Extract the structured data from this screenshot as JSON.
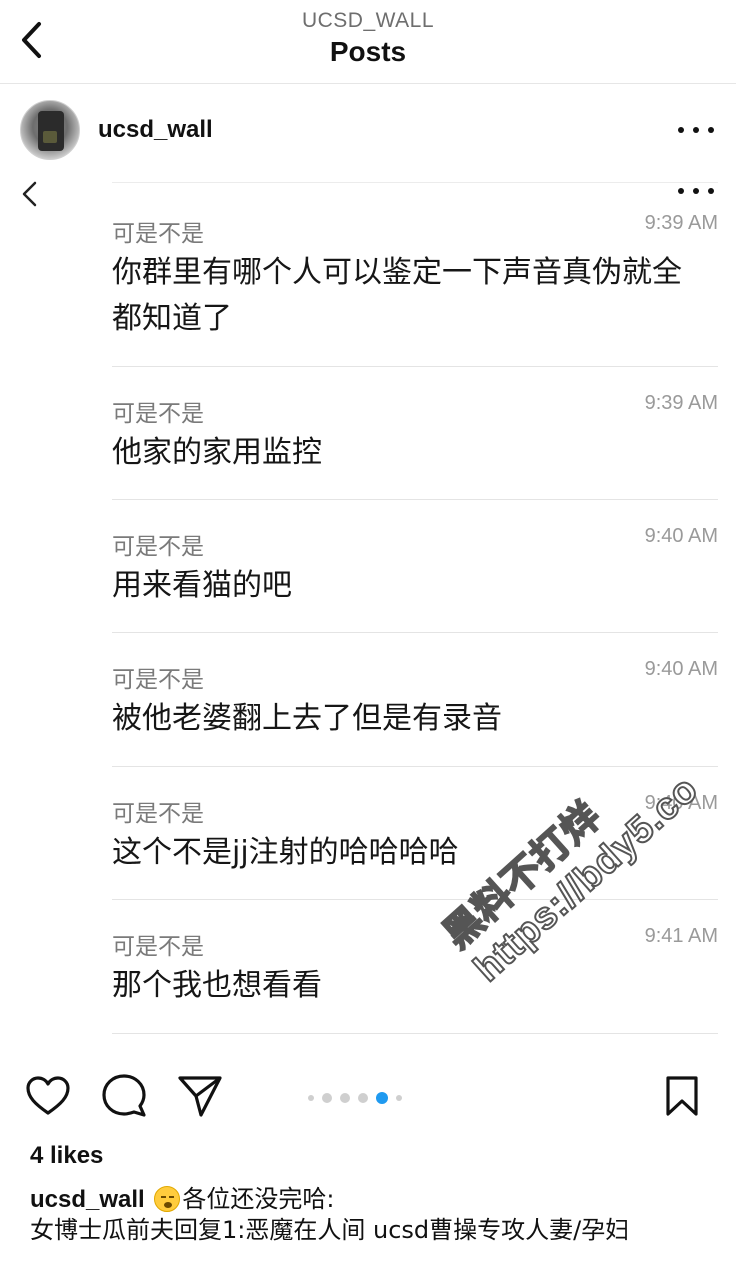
{
  "header": {
    "account": "UCSD_WALL",
    "title": "Posts"
  },
  "post": {
    "author": "ucsd_wall",
    "messages": [
      {
        "sender": "可是不是",
        "time": "9:39 AM",
        "text": "你群里有哪个人可以鉴定一下声音真伪就全都知道了"
      },
      {
        "sender": "可是不是",
        "time": "9:39 AM",
        "text": "他家的家用监控"
      },
      {
        "sender": "可是不是",
        "time": "9:40 AM",
        "text": "用来看猫的吧"
      },
      {
        "sender": "可是不是",
        "time": "9:40 AM",
        "text": "被他老婆翻上去了但是有录音"
      },
      {
        "sender": "可是不是",
        "time": "9:40 AM",
        "text": "这个不是jj注射的哈哈哈哈"
      },
      {
        "sender": "可是不是",
        "time": "9:41 AM",
        "text": "那个我也想看看"
      }
    ],
    "watermark": {
      "line1": "黑料不打烊",
      "line2": "https://bdy5.co"
    },
    "carousel": {
      "total": 6,
      "active_index": 4
    },
    "likes": "4 likes",
    "caption": {
      "user": "ucsd_wall",
      "emoji": "face-exhaling-emoji",
      "text1": "各位还没完哈:",
      "text2": "女博士瓜前夫回复1:恶魔在人间 ucsd曹操专攻人妻/孕妇"
    }
  },
  "icons": {
    "back": "chevron-left-icon",
    "more": "more-horizontal-icon",
    "like": "heart-icon",
    "comment": "comment-icon",
    "share": "paper-plane-icon",
    "save": "bookmark-icon"
  }
}
